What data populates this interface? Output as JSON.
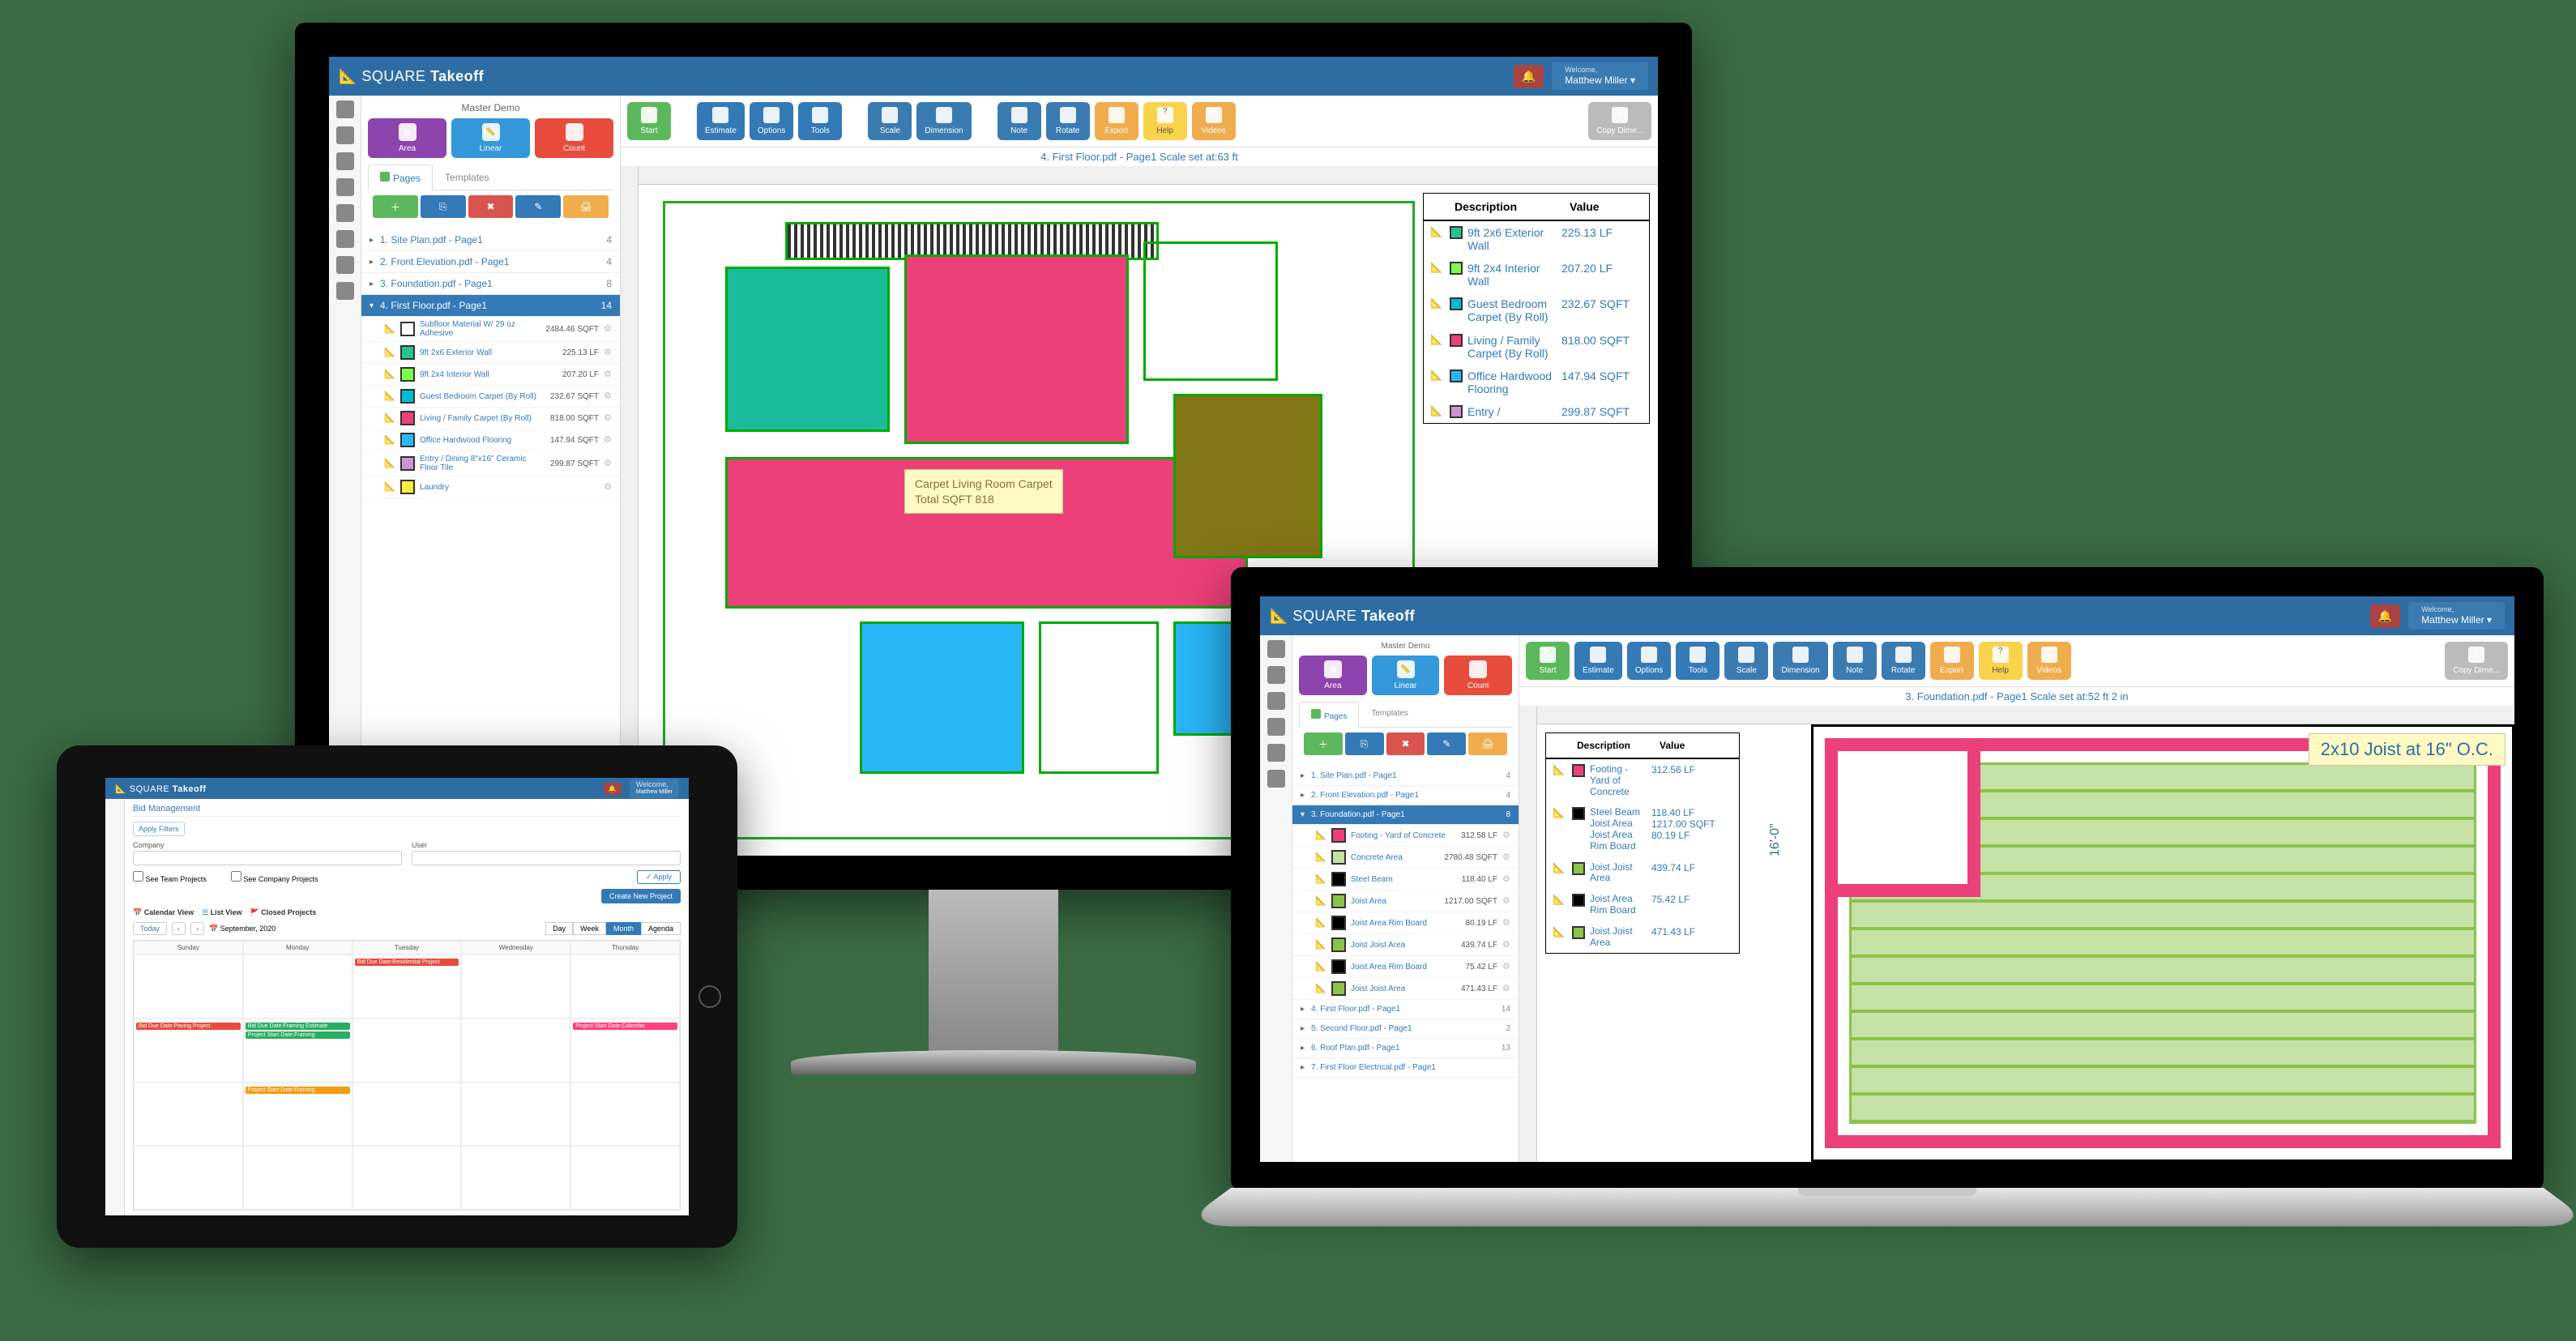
{
  "brand_a": "SQUARE",
  "brand_b": "Takeoff",
  "welcome_label": "Welcome,",
  "user_name": "Matthew Miller",
  "desktop": {
    "project": "Master Demo",
    "tools": {
      "area": "Area",
      "linear": "Linear",
      "count": "Count"
    },
    "tabs": {
      "pages": "Pages",
      "templates": "Templates"
    },
    "toolbar": {
      "start": "Start",
      "estimate": "Estimate",
      "options": "Options",
      "tools": "Tools",
      "scale": "Scale",
      "dimension": "Dimension",
      "note": "Note",
      "rotate": "Rotate",
      "export": "Export",
      "help": "Help",
      "videos": "Videos",
      "copy": "Copy Dime..."
    },
    "page_title": "4. First Floor.pdf - Page1 Scale set at:63 ft",
    "pages": [
      {
        "name": "1. Site Plan.pdf - Page1",
        "count": "4"
      },
      {
        "name": "2. Front Elevation.pdf - Page1",
        "count": "4"
      },
      {
        "name": "3. Foundation.pdf - Page1",
        "count": "8"
      },
      {
        "name": "4. First Floor.pdf - Page1",
        "count": "14"
      }
    ],
    "measures": [
      {
        "color": "#ffffff",
        "desc": "Subfloor Material W/ 29 oz Adhesive",
        "val": "2484.46 SQFT"
      },
      {
        "color": "#27c290",
        "desc": "9ft 2x6 Exterior Wall",
        "val": "225.13 LF"
      },
      {
        "color": "#7cff4a",
        "desc": "9ft 2x4 Interior Wall",
        "val": "207.20 LF"
      },
      {
        "color": "#00bcd4",
        "desc": "Guest Bedroom Carpet (By Roll)",
        "val": "232.67 SQFT"
      },
      {
        "color": "#ec407a",
        "desc": "Living / Family Carpet (By Roll)",
        "val": "818.00 SQFT"
      },
      {
        "color": "#29b6f6",
        "desc": "Office Hardwood Flooring",
        "val": "147.94 SQFT"
      },
      {
        "color": "#ce93d8",
        "desc": "Entry / Dining 8\"x16\" Ceramic Floor Tile",
        "val": "299.87 SQFT"
      },
      {
        "color": "#ffeb3b",
        "desc": "Laundry",
        "val": ""
      }
    ],
    "results_head": {
      "desc": "Description",
      "val": "Value"
    },
    "results": [
      {
        "color": "#27c290",
        "desc": "9ft 2x6 Exterior Wall",
        "val": "225.13 LF"
      },
      {
        "color": "#7cff4a",
        "desc": "9ft 2x4 Interior Wall",
        "val": "207.20 LF"
      },
      {
        "color": "#00bcd4",
        "desc": "Guest Bedroom Carpet (By Roll)",
        "val": "232.67 SQFT"
      },
      {
        "color": "#ec407a",
        "desc": "Living / Family Carpet (By Roll)",
        "val": "818.00 SQFT"
      },
      {
        "color": "#29b6f6",
        "desc": "Office Hardwood Flooring",
        "val": "147.94 SQFT"
      },
      {
        "color": "#ce93d8",
        "desc": "Entry /",
        "val": "299.87 SQFT"
      }
    ],
    "tooltip_l1": "Carpet Living Room Carpet",
    "tooltip_l2": "Total SQFT 818"
  },
  "laptop": {
    "project": "Master Demo",
    "page_title": "3. Foundation.pdf - Page1 Scale set at:52 ft 2 in",
    "pages": [
      {
        "name": "1. Site Plan.pdf - Page1",
        "count": "4"
      },
      {
        "name": "2. Front Elevation.pdf - Page1",
        "count": "4"
      },
      {
        "name": "3. Foundation.pdf - Page1",
        "count": "8"
      },
      {
        "name": "4. First Floor.pdf - Page1",
        "count": "14"
      },
      {
        "name": "5. Second Floor.pdf - Page1",
        "count": "2"
      },
      {
        "name": "6. Roof Plan.pdf - Page1",
        "count": "13"
      },
      {
        "name": "7. First Floor Electrical.pdf - Page1",
        "count": ""
      }
    ],
    "measures": [
      {
        "color": "#ec407a",
        "desc": "Footing - Yard of Concrete",
        "val": "312.58 LF"
      },
      {
        "color": "#c5e1a5",
        "desc": "Concrete Area",
        "val": "2780.48 SQFT"
      },
      {
        "color": "#000000",
        "desc": "Steel Beam",
        "val": "118.40 LF"
      },
      {
        "color": "#8bc34a",
        "desc": "Joist Area",
        "val": "1217.00 SQFT"
      },
      {
        "color": "#000000",
        "desc": "Joist Area Rim Board",
        "val": "80.19 LF"
      },
      {
        "color": "#8bc34a",
        "desc": "Joist Joist Area",
        "val": "439.74 LF"
      },
      {
        "color": "#000000",
        "desc": "Joist Area Rim Board",
        "val": "75.42 LF"
      },
      {
        "color": "#8bc34a",
        "desc": "Joist Joist Area",
        "val": "471.43 LF"
      }
    ],
    "results": [
      {
        "color": "#ec407a",
        "desc": "Footing - Yard of Concrete",
        "val": "312.56 LF"
      },
      {
        "color": "#000000",
        "desc": "Steel Beam\nJoist Area\nJoist Area Rim Board",
        "val": "118.40 LF\n1217.00 SQFT\n80.19 LF"
      },
      {
        "color": "#8bc34a",
        "desc": "Joist Joist Area",
        "val": "439.74 LF"
      },
      {
        "color": "#000000",
        "desc": "Joist Area Rim Board",
        "val": "75.42 LF"
      },
      {
        "color": "#8bc34a",
        "desc": "Joist Joist Area",
        "val": "471.43 LF"
      }
    ],
    "joist_label": "2x10 Joist at 16\" O.C.",
    "dim": "16'-0\""
  },
  "tablet": {
    "title": "Bid Management",
    "apply_filters": "Apply Filters",
    "company": "Company",
    "user": "User",
    "see_team": "See Team Projects",
    "see_company": "See Company Projects",
    "apply": "✓ Apply",
    "create": "Create New Project",
    "views": {
      "cal": "Calendar View",
      "list": "List View",
      "closed": "Closed Projects"
    },
    "today": "Today",
    "month": "September, 2020",
    "modes": {
      "day": "Day",
      "week": "Week",
      "month": "Month",
      "agenda": "Agenda"
    },
    "days": [
      "Sunday",
      "Monday",
      "Tuesday",
      "Wednesday",
      "Thursday"
    ],
    "events": {
      "r1": "Bid Due Date:Residential Project",
      "r2": "Bid Due Date:Paving Project",
      "g1": "Bid Due Date:Framing Estimate",
      "g2": "Project Start Date:Framing",
      "p1": "Project Start Date:Calendar",
      "o1": "Project Start Date:Framing"
    }
  }
}
